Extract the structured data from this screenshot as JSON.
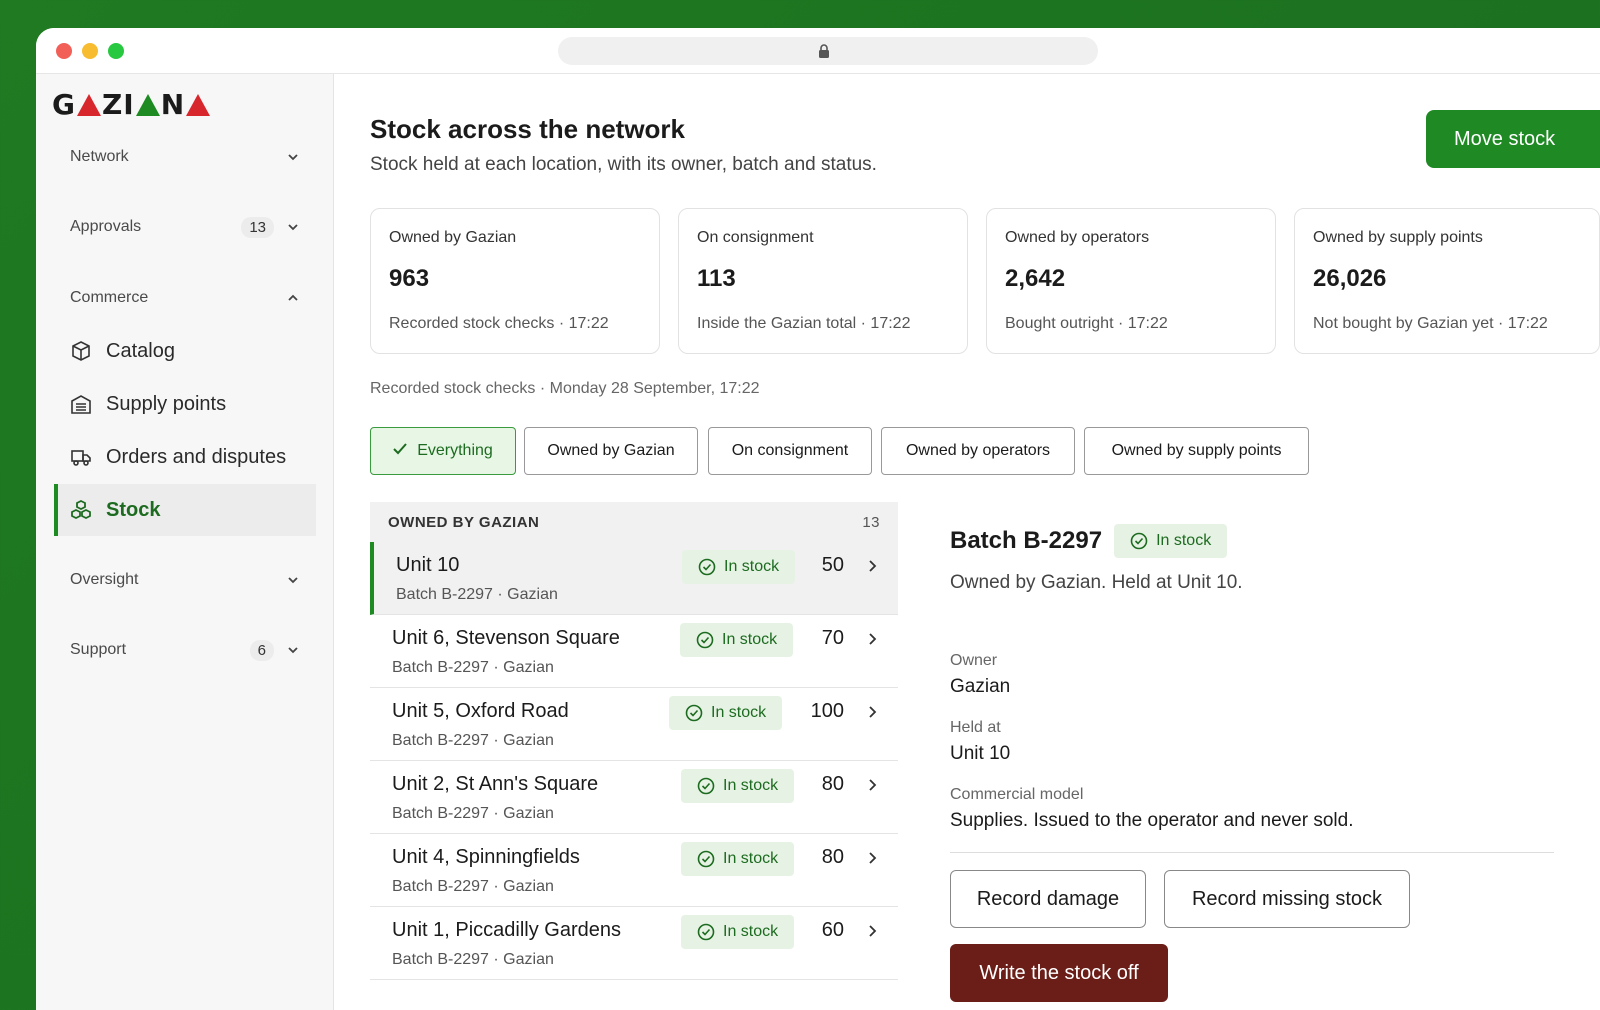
{
  "brand": {
    "name": "GAZIANA"
  },
  "sidebar": {
    "sections": [
      {
        "label": "Network"
      },
      {
        "label": "Approvals",
        "count": "13"
      },
      {
        "label": "Commerce"
      },
      {
        "label": "Oversight"
      },
      {
        "label": "Support",
        "count": "6"
      }
    ],
    "items": [
      {
        "label": "Catalog",
        "icon": "box-icon"
      },
      {
        "label": "Supply points",
        "icon": "building-icon"
      },
      {
        "label": "Orders and disputes",
        "icon": "truck-icon"
      },
      {
        "label": "Stock",
        "icon": "cubes-icon",
        "active": true
      }
    ]
  },
  "header": {
    "title": "Stock across the network",
    "subtitle": "Stock held at each location, with its owner, batch and status.",
    "move_button": "Move stock"
  },
  "cards": [
    {
      "title": "Owned by Gazian",
      "value": "963",
      "sub": "Recorded stock checks · 17:22"
    },
    {
      "title": "On consignment",
      "value": "113",
      "sub": "Inside the Gazian total · 17:22"
    },
    {
      "title": "Owned by operators",
      "value": "2,642",
      "sub": "Bought outright · 17:22"
    },
    {
      "title": "Owned by supply points",
      "value": "26,026",
      "sub": "Not bought by Gazian yet · 17:22"
    }
  ],
  "recorded_line": "Recorded stock checks · Monday 28 September, 17:22",
  "filters": [
    {
      "label": "Everything",
      "active": true
    },
    {
      "label": "Owned by Gazian"
    },
    {
      "label": "On consignment"
    },
    {
      "label": "Owned by operators"
    },
    {
      "label": "Owned by supply points"
    }
  ],
  "list": {
    "header": "OWNED BY GAZIAN",
    "count": "13",
    "rows": [
      {
        "name": "Unit 10",
        "batch": "Batch B-2297 · Gazian",
        "status": "In stock",
        "qty": "50"
      },
      {
        "name": "Unit 6, Stevenson Square",
        "batch": "Batch B-2297 · Gazian",
        "status": "In stock",
        "qty": "70"
      },
      {
        "name": "Unit 5, Oxford Road",
        "batch": "Batch B-2297 · Gazian",
        "status": "In stock",
        "qty": "100"
      },
      {
        "name": "Unit 2, St Ann's Square",
        "batch": "Batch B-2297 · Gazian",
        "status": "In stock",
        "qty": "80"
      },
      {
        "name": "Unit 4, Spinningfields",
        "batch": "Batch B-2297 · Gazian",
        "status": "In stock",
        "qty": "80"
      },
      {
        "name": "Unit 1, Piccadilly Gardens",
        "batch": "Batch B-2297 · Gazian",
        "status": "In stock",
        "qty": "60"
      }
    ]
  },
  "detail": {
    "title": "Batch B-2297",
    "status": "In stock",
    "subtitle": "Owned by Gazian. Held at Unit 10.",
    "owner_label": "Owner",
    "owner_value": "Gazian",
    "held_label": "Held at",
    "held_value": "Unit 10",
    "model_label": "Commercial model",
    "model_value": "Supplies. Issued to the operator and never sold.",
    "record_damage": "Record damage",
    "record_missing": "Record missing stock",
    "write_off": "Write the stock off"
  },
  "colors": {
    "accent": "#1f8a24",
    "danger": "#6b1d17",
    "badge_bg": "#e6f3e4"
  }
}
